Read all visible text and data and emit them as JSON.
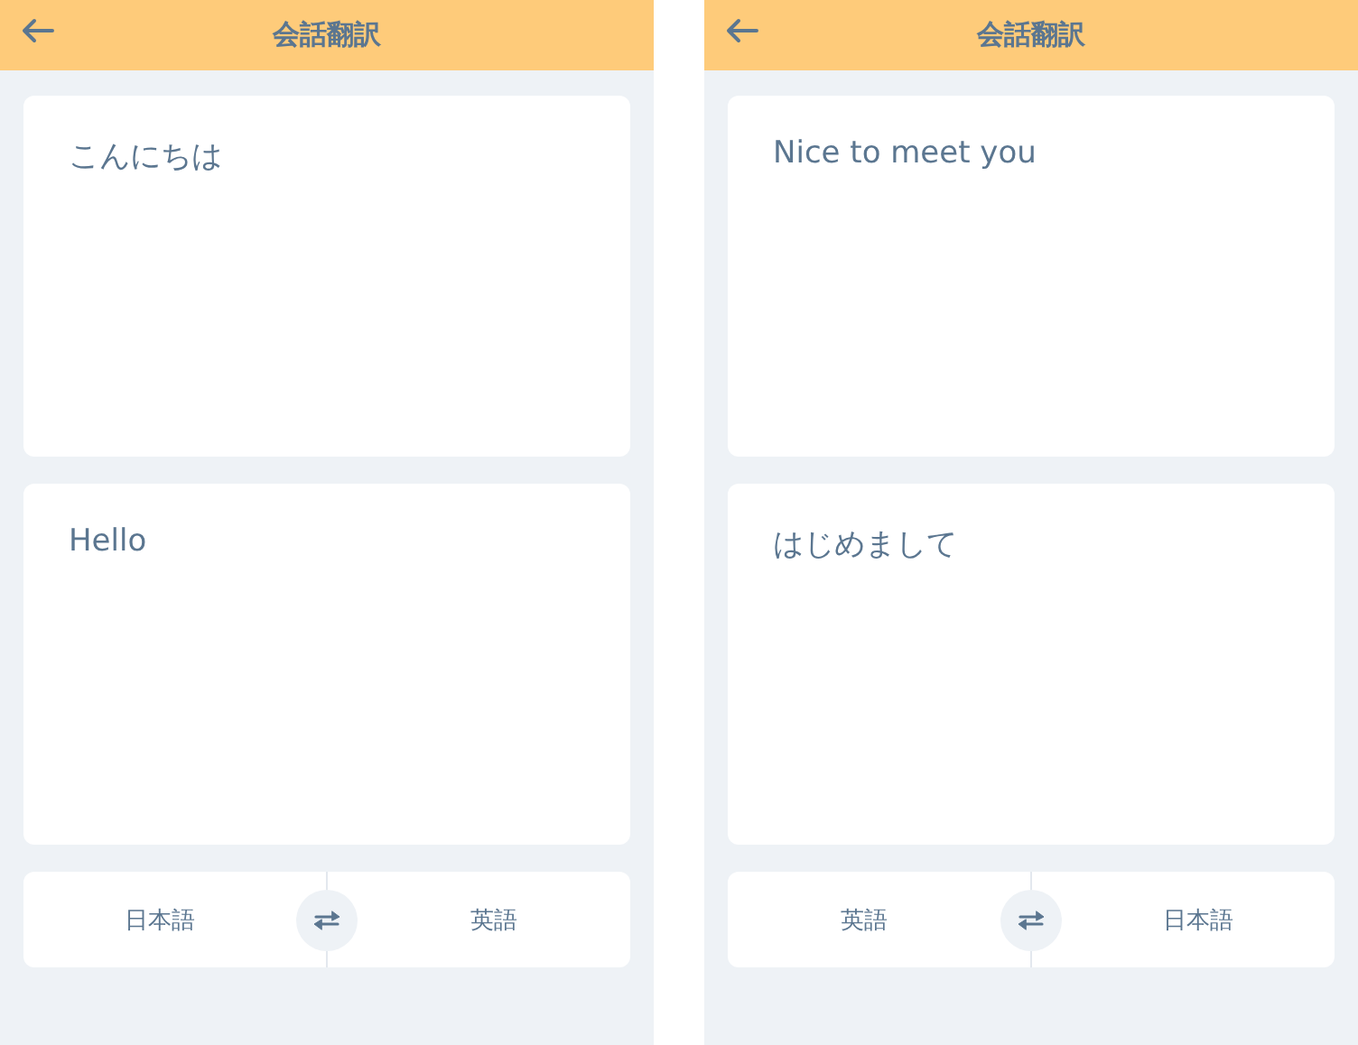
{
  "screens": [
    {
      "title": "会話翻訳",
      "source_text": "こんにちは",
      "result_text": "Hello",
      "languages": [
        "日本語",
        "英語"
      ]
    },
    {
      "title": "会話翻訳",
      "source_text": "Nice to meet you",
      "result_text": "はじめまして",
      "languages": [
        "英語",
        "日本語"
      ]
    }
  ]
}
